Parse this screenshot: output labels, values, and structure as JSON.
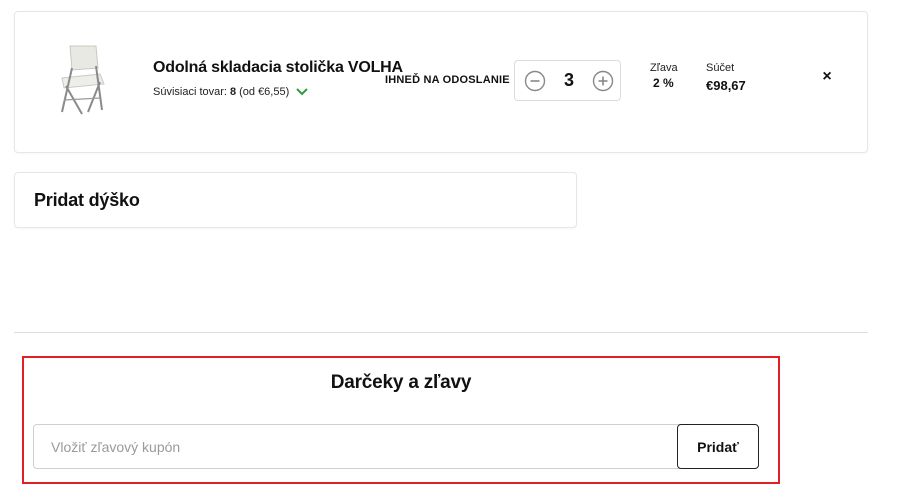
{
  "cart_item": {
    "name": "Odolná skladacia stolička VOLHA",
    "related_label": "Súvisiaci tovar:",
    "related_count": "8",
    "related_price": "(od €6,55)",
    "shipping": "IHNEĎ NA ODOSLANIE",
    "quantity": "3",
    "discount_label": "Zľava",
    "discount_value": "2 %",
    "sum_label": "Súčet",
    "sum_value": "€98,67",
    "remove_symbol": "×"
  },
  "tip": {
    "title": "Pridat dýško"
  },
  "gifts": {
    "title": "Darčeky a zľavy",
    "coupon_placeholder": "Vložiť zľavový kupón",
    "coupon_value": "",
    "add_label": "Pridať"
  },
  "colors": {
    "highlight_border": "#e31e24",
    "chevron": "#2e9b3c",
    "stepper_icon": "#888888"
  },
  "icons": [
    "chair-product-image",
    "chevron-down-icon",
    "minus-circle-icon",
    "plus-circle-icon",
    "close-icon"
  ]
}
